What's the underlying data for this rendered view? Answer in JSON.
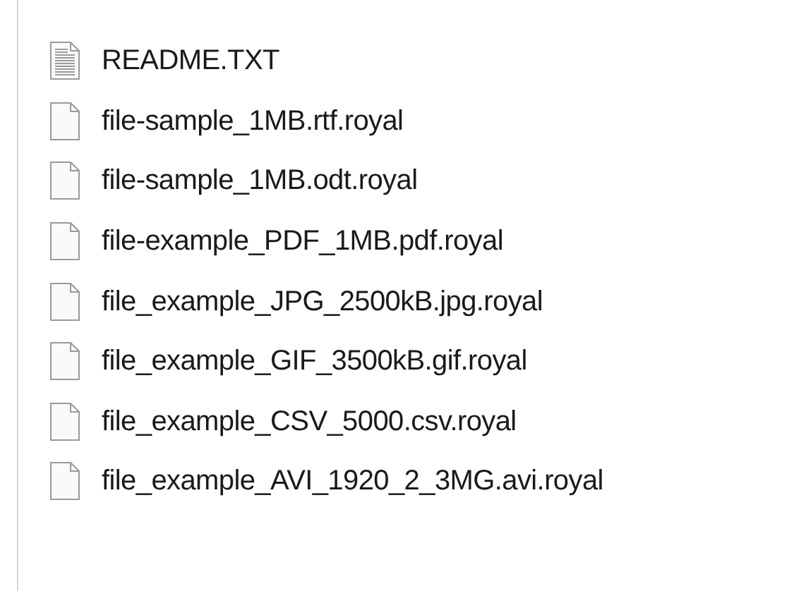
{
  "files": [
    {
      "name": "README.TXT",
      "kind": "text"
    },
    {
      "name": "file-sample_1MB.rtf.royal",
      "kind": "blank"
    },
    {
      "name": "file-sample_1MB.odt.royal",
      "kind": "blank"
    },
    {
      "name": "file-example_PDF_1MB.pdf.royal",
      "kind": "blank"
    },
    {
      "name": "file_example_JPG_2500kB.jpg.royal",
      "kind": "blank"
    },
    {
      "name": "file_example_GIF_3500kB.gif.royal",
      "kind": "blank"
    },
    {
      "name": "file_example_CSV_5000.csv.royal",
      "kind": "blank"
    },
    {
      "name": "file_example_AVI_1920_2_3MG.avi.royal",
      "kind": "blank"
    }
  ]
}
